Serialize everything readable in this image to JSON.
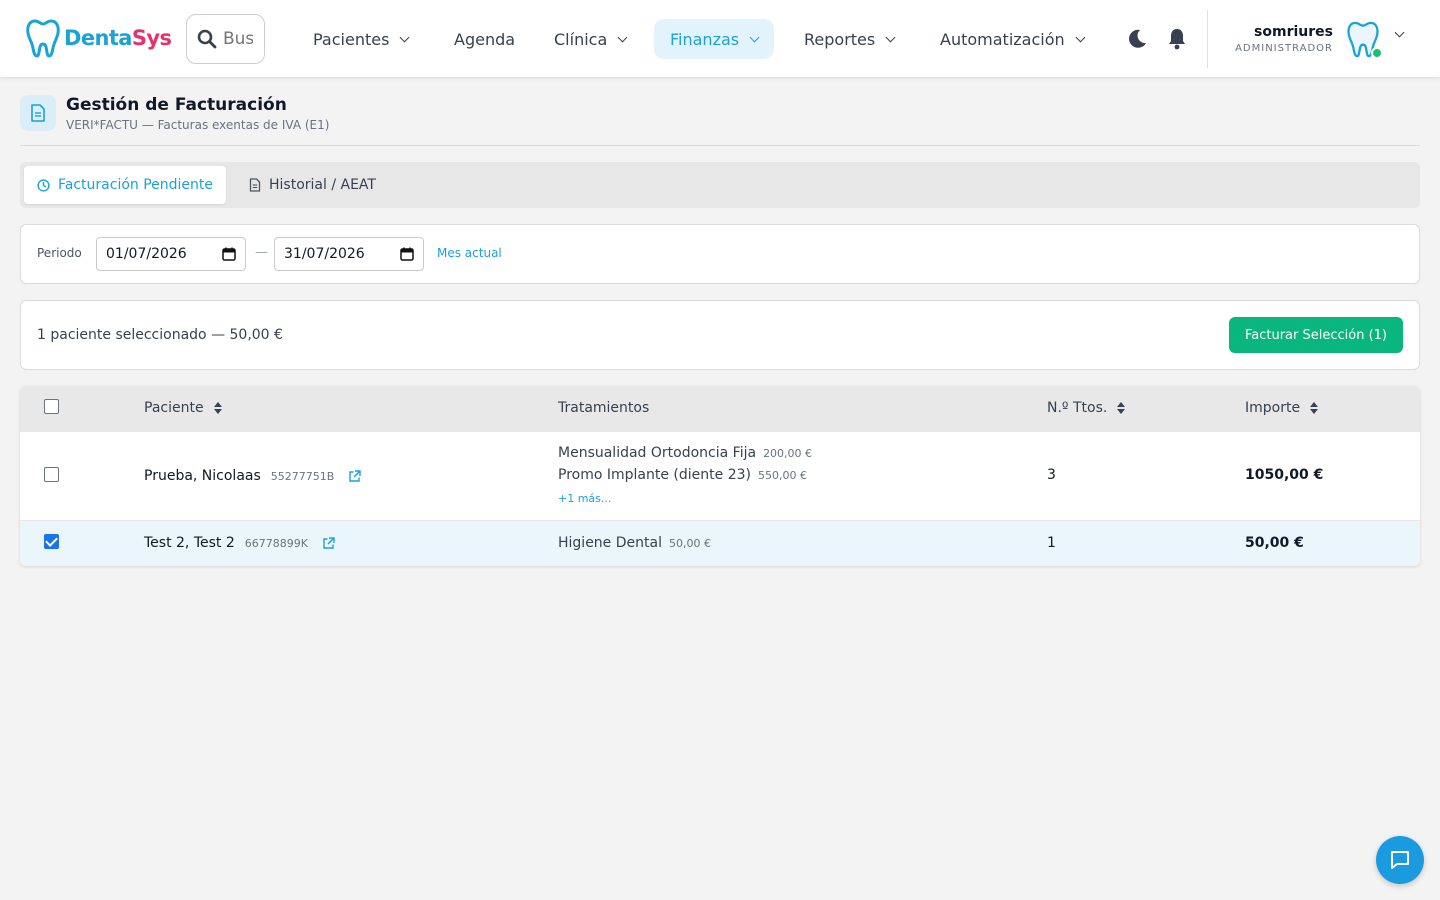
{
  "app": {
    "logo_part1": "Denta",
    "logo_part2": "Sys",
    "search_placeholder": "Buscar",
    "nav": [
      {
        "label": "Pacientes",
        "has_dropdown": true,
        "active": false
      },
      {
        "label": "Agenda",
        "has_dropdown": false,
        "active": false
      },
      {
        "label": "Clínica",
        "has_dropdown": true,
        "active": false
      },
      {
        "label": "Finanzas",
        "has_dropdown": true,
        "active": true
      },
      {
        "label": "Reportes",
        "has_dropdown": true,
        "active": false
      },
      {
        "label": "Automatización",
        "has_dropdown": true,
        "active": false
      }
    ],
    "user": {
      "name": "somriures",
      "role": "ADMINISTRADOR",
      "status": "online"
    }
  },
  "page": {
    "title": "Gestión de Facturación",
    "subtitle": "VERI*FACTU — Facturas exentas de IVA (E1)"
  },
  "tabs": [
    {
      "label": "Facturación Pendiente",
      "icon": "clock-icon",
      "active": true
    },
    {
      "label": "Historial / AEAT",
      "icon": "document-icon",
      "active": false
    }
  ],
  "filter": {
    "label": "Periodo",
    "from": "01/07/2026",
    "to": "31/07/2026",
    "separator": "—",
    "current_month_link": "Mes actual"
  },
  "summary": {
    "text": "1 paciente seleccionado — 50,00 €",
    "action_label": "Facturar Selección (1)"
  },
  "table": {
    "columns": [
      "Paciente",
      "Tratamientos",
      "N.º Ttos.",
      "Importe"
    ],
    "rows": [
      {
        "selected": false,
        "patient": "Prueba, Nicolaas",
        "id": "55277751B",
        "treatments": [
          {
            "name": "Mensualidad Ortodoncia Fija",
            "price": "200,00 €"
          },
          {
            "name": "Promo Implante (diente 23)",
            "price": "550,00 €"
          }
        ],
        "more": "+1 más...",
        "count": "3",
        "amount": "1050,00 €"
      },
      {
        "selected": true,
        "patient": "Test 2, Test 2",
        "id": "66778899K",
        "treatments": [
          {
            "name": "Higiene Dental",
            "price": "50,00 €"
          }
        ],
        "count": "1",
        "amount": "50,00 €"
      }
    ]
  },
  "colors": {
    "accent": "#1aa3d4",
    "brand_pink": "#e2336f",
    "primary_button": "#08b67e",
    "selected_row": "#eaf6fc",
    "chat_button": "#1a9be0"
  }
}
